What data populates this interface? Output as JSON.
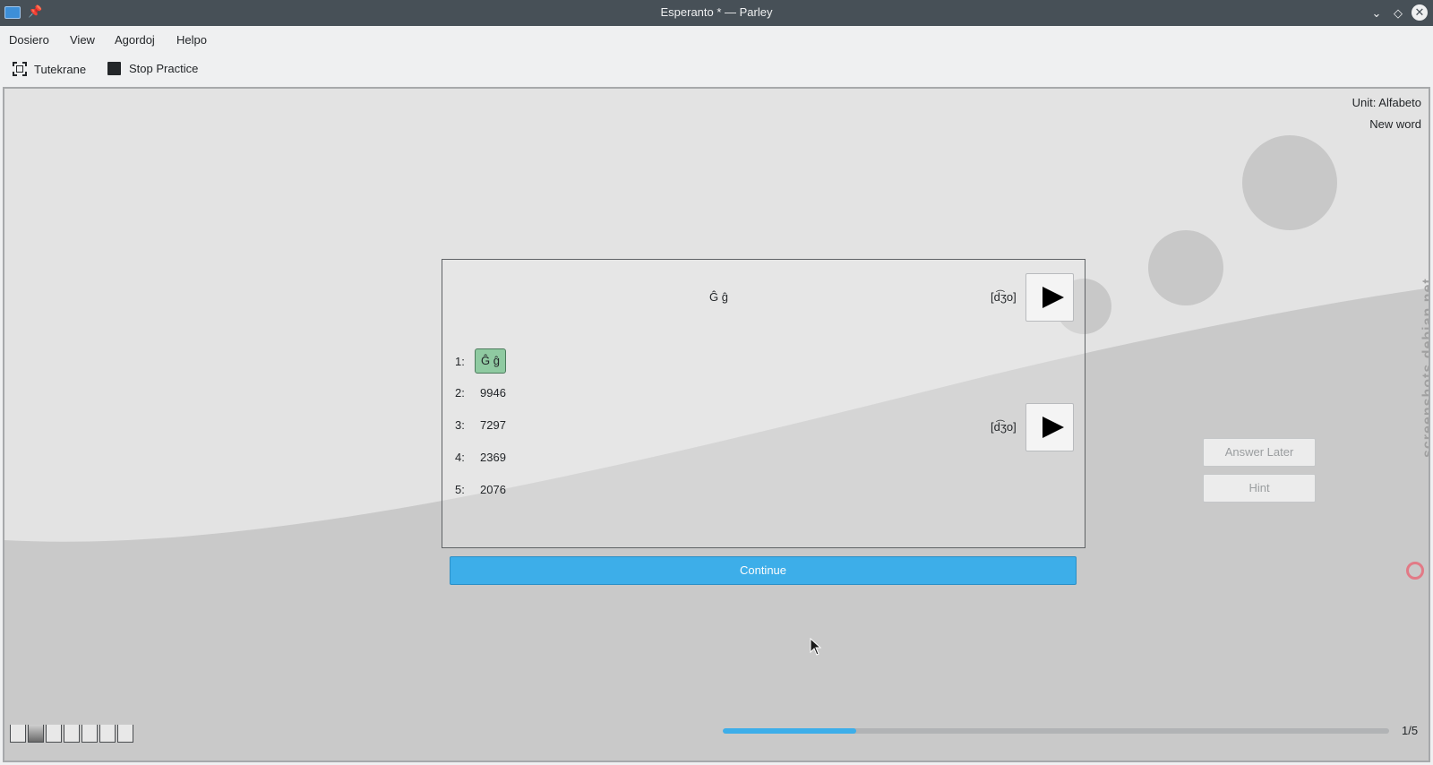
{
  "window": {
    "title": "Esperanto * — Parley",
    "min_icon": "chevron-down-icon",
    "max_icon": "diamond-icon",
    "close_icon": "close-icon"
  },
  "menu": [
    "Dosiero",
    "View",
    "Agordoj",
    "Helpo"
  ],
  "toolbar": {
    "fullscreen_label": "Tutekrane",
    "stop_label": "Stop Practice"
  },
  "practice": {
    "unit": "Unit: Alfabeto",
    "status": "New word",
    "question": "Ĝ ĝ",
    "question_pron": "[d͡ʒo]",
    "answer_pron": "[d͡ʒo]",
    "choices": [
      {
        "num": "1:",
        "text": "Ĝ ĝ",
        "correct": true
      },
      {
        "num": "2:",
        "text": "9946",
        "correct": false
      },
      {
        "num": "3:",
        "text": "7297",
        "correct": false
      },
      {
        "num": "4:",
        "text": "2369",
        "correct": false
      },
      {
        "num": "5:",
        "text": "2076",
        "correct": false
      }
    ],
    "continue_label": "Continue",
    "answer_later_label": "Answer Later",
    "hint_label": "Hint",
    "progress_text": "1/5",
    "progress_fraction": 0.2,
    "score_boxes": 7
  },
  "watermark": "screenshots.debian.net",
  "colors": {
    "accent": "#3daee9",
    "correct": "#8fcaa1",
    "titlebar": "#475057"
  }
}
